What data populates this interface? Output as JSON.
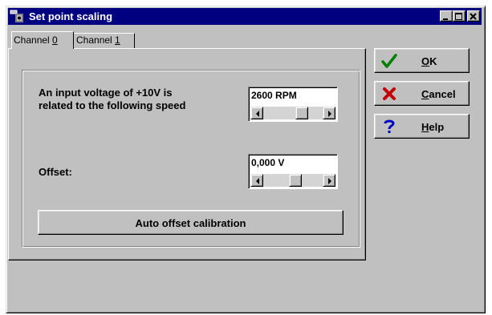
{
  "window": {
    "title": "Set point scaling"
  },
  "tabs": [
    {
      "label": "Channel ",
      "accel": "0"
    },
    {
      "label": "Channel ",
      "accel": "1"
    }
  ],
  "speed": {
    "label_line1": "An input voltage of +10V is",
    "label_line2": "related to the following speed",
    "value": "2600 RPM"
  },
  "offset": {
    "label": "Offset:",
    "value": "0,000 V"
  },
  "auto_offset": {
    "label": "Auto offset calibration"
  },
  "buttons": {
    "ok": {
      "accel": "O",
      "rest": "K",
      "icon": "checkmark-icon",
      "color": "#008000"
    },
    "cancel": {
      "accel": "C",
      "rest": "ancel",
      "icon": "x-icon",
      "color": "#c00000"
    },
    "help": {
      "accel": "H",
      "rest": "elp",
      "icon": "question-icon",
      "color": "#0000c0"
    }
  }
}
